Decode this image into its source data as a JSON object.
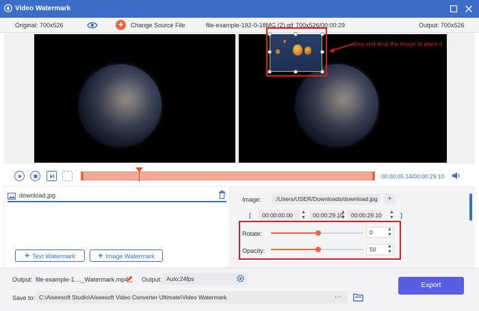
{
  "window": {
    "title": "Video Watermark"
  },
  "infobar": {
    "original": "Original: 700x526",
    "change_source": "Change Source File",
    "filename": "file-example-192-0-18MG (2).gif",
    "dims_time": "700x526/00:00:29",
    "output": "Output: 700x526"
  },
  "preview": {
    "callout": "drag and drop the image to place it"
  },
  "timeline": {
    "time": "00:00:05.14/00:00:29.10"
  },
  "layers": {
    "item_label": "download.jpg",
    "text_watermark": "Text Watermark",
    "image_watermark": "Image Watermark"
  },
  "settings": {
    "image_label": "Image:",
    "image_path": ":/Users/USER/Downloads/download.jpg",
    "start_time": "00:00:00.00",
    "duration": "00:00:29.10",
    "end_time": "00:00:29.10",
    "bracket_open": "[",
    "bracket_close": "]",
    "rotate_label": "Rotate:",
    "rotate_value": "0",
    "opacity_label": "Opacity:",
    "opacity_value": "50"
  },
  "bottom": {
    "output_label": "Output:",
    "output_file": "file-example-1...._Watermark.mp4",
    "output2_label": "Output:",
    "output_format": "Auto;24fps",
    "save_label": "Save to:",
    "save_path": "C:\\Aiseesoft Studio\\Aiseesoft Video Converter Ultimate\\Video Watermark",
    "more": "···",
    "export": "Export"
  },
  "colors": {
    "accent": "#3d6ec7",
    "orange": "#f0653f",
    "highlight": "#d81e1e",
    "export": "#5a5ee4"
  }
}
